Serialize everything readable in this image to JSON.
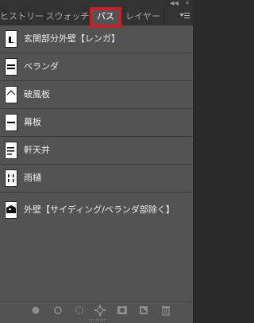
{
  "tabs": [
    {
      "label": "ヒストリー",
      "active": false
    },
    {
      "label": "スウォッチ",
      "active": false
    },
    {
      "label": "パス",
      "active": true
    },
    {
      "label": "レイヤー",
      "active": false
    }
  ],
  "header": {
    "collapse_icon": "double-chevron-left-icon",
    "close_icon": "close-icon",
    "menu_icon": "panel-menu-icon"
  },
  "paths": [
    {
      "label": "玄関部分外壁【レンガ】"
    },
    {
      "label": "ベランダ"
    },
    {
      "label": "破風板"
    },
    {
      "label": "幕板"
    },
    {
      "label": "軒天井"
    },
    {
      "label": "雨樋"
    },
    {
      "label": "外壁【サイディング/ベランダ部除く】"
    }
  ],
  "toolbar": [
    {
      "name": "fill-path-icon"
    },
    {
      "name": "stroke-path-icon"
    },
    {
      "name": "load-as-selection-icon"
    },
    {
      "name": "make-work-path-icon"
    },
    {
      "name": "add-mask-icon"
    },
    {
      "name": "create-new-path-icon"
    },
    {
      "name": "delete-path-icon"
    }
  ],
  "colors": {
    "highlight": "#e3151b",
    "panel": "#535353",
    "tabbar": "#323232"
  }
}
